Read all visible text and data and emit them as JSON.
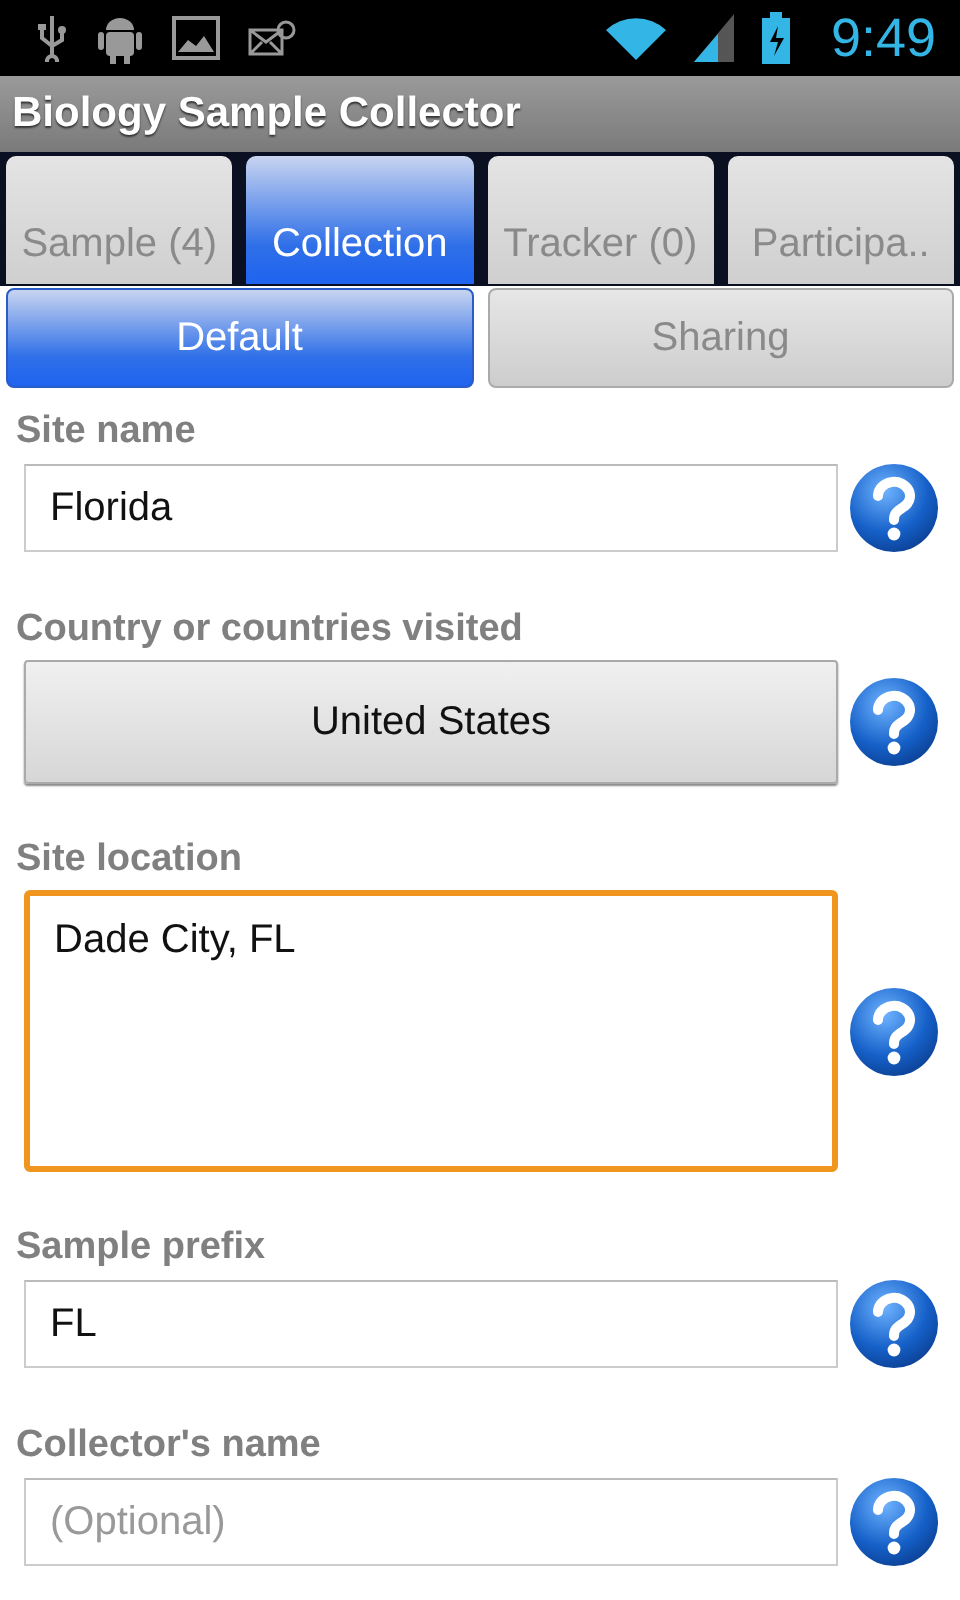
{
  "status_bar": {
    "time": "9:49"
  },
  "app_bar": {
    "title": "Biology Sample Collector"
  },
  "tabs": [
    {
      "label": "Sample (4)",
      "selected": false
    },
    {
      "label": "Collection",
      "selected": true
    },
    {
      "label": "Tracker (0)",
      "selected": false
    },
    {
      "label": "Participa..",
      "selected": false
    }
  ],
  "subtabs": [
    {
      "label": "Default",
      "selected": true
    },
    {
      "label": "Sharing",
      "selected": false
    }
  ],
  "fields": [
    {
      "kind": "text",
      "label": "Site name",
      "value": "Florida",
      "focused": false
    },
    {
      "kind": "button",
      "label": "Country or countries visited",
      "value": "United States",
      "focused": false
    },
    {
      "kind": "textarea",
      "label": "Site location",
      "value": "Dade City, FL",
      "focused": true
    },
    {
      "kind": "text",
      "label": "Sample prefix",
      "value": "FL",
      "focused": false
    },
    {
      "kind": "text",
      "label": "Collector's name",
      "placeholder": "(Optional)",
      "focused": false
    }
  ]
}
